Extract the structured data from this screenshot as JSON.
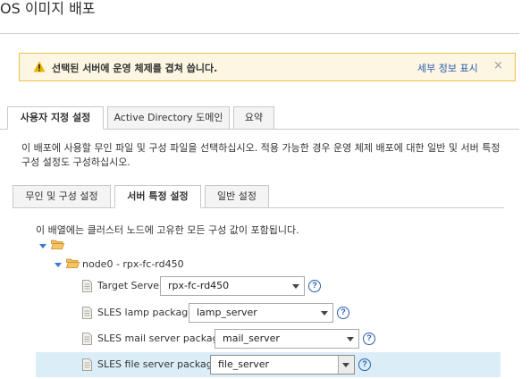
{
  "page": {
    "title": "OS 이미지 배포"
  },
  "alert": {
    "message": "선택된 서버에 운영 체제를 겹쳐 씁니다.",
    "details_link": "세부 정보 표시",
    "close_glyph": "×",
    "icon": "warning-icon",
    "border_color": "#f0c04a",
    "background_color": "#fdf6e3"
  },
  "main_tabs": [
    {
      "label": "사용자 지정 설정",
      "active": true
    },
    {
      "label": "Active Directory 도메인",
      "active": false
    },
    {
      "label": "요약",
      "active": false
    }
  ],
  "description": "이 배포에 사용할 무인 파일 및 구성 파일을 선택하십시오. 적용 가능한 경우 운영 체제 배포에 대한 일반 및 서버 특정 구성 설정도 구성하십시오.",
  "sub_tabs": [
    {
      "label": "무인 및 구성 설정",
      "active": false
    },
    {
      "label": "서버 특정 설정",
      "active": true
    },
    {
      "label": "일반 설정",
      "active": false
    }
  ],
  "tree_note": "이 배열에는 클러스터 노드에 고유한 모든 구성 값이 포함됩니다.",
  "tree": {
    "node_label": "node0 - rpx-fc-rd450",
    "settings": [
      {
        "label": "Target Server",
        "value": "rpx-fc-rd450"
      },
      {
        "label": "SLES lamp package.",
        "value": "lamp_server"
      },
      {
        "label": "SLES mail server package",
        "value": "mail_server"
      },
      {
        "label": "SLES file server package",
        "value": "file_server"
      }
    ],
    "help_glyph": "?"
  },
  "colors": {
    "accent": "#2a5db0",
    "expander": "#3a7bd5",
    "folder": "#e8a93a",
    "row_highlight": "#dbeef7"
  }
}
